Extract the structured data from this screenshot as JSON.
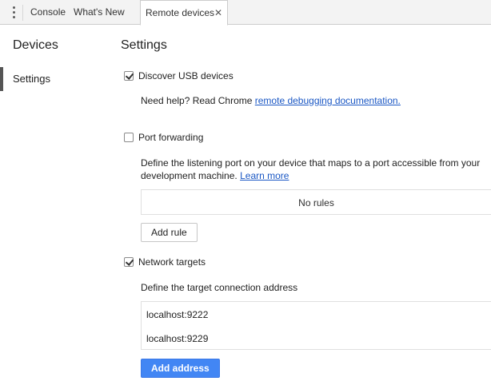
{
  "tabs": {
    "console": "Console",
    "whats_new": "What's New",
    "remote_devices": "Remote devices",
    "close_glyph": "✕"
  },
  "sidebar": {
    "title": "Devices",
    "items": [
      {
        "label": "Settings",
        "selected": true
      }
    ]
  },
  "settings": {
    "title": "Settings",
    "discover_usb": {
      "label": "Discover USB devices",
      "checked": true,
      "help_prefix": "Need help? Read Chrome ",
      "help_link": "remote debugging documentation."
    },
    "port_forwarding": {
      "label": "Port forwarding",
      "checked": false,
      "description_line1": "Define the listening port on your device that maps to a port accessible from your",
      "description_line2": "development machine.",
      "learn_more": "Learn more",
      "empty_rules": "No rules",
      "add_rule_button": "Add rule"
    },
    "network_targets": {
      "label": "Network targets",
      "checked": true,
      "description": "Define the target connection address",
      "addresses": [
        "localhost:9222",
        "localhost:9229"
      ],
      "add_address_button": "Add address"
    }
  },
  "colors": {
    "accent": "#4286f4",
    "link": "#1a57c4"
  }
}
